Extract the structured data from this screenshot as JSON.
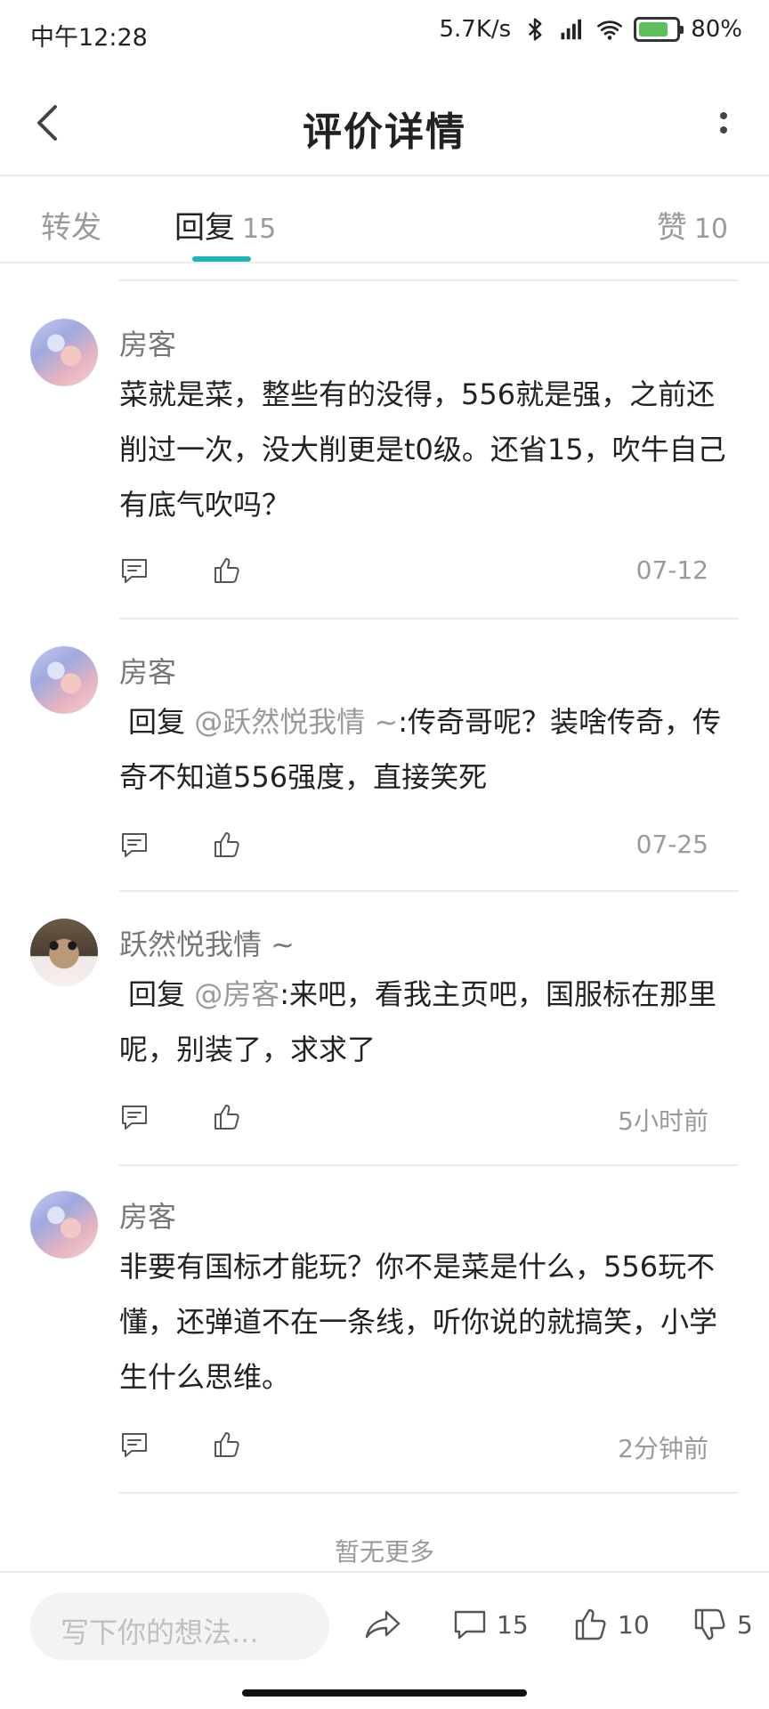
{
  "status_bar": {
    "time": "中午12:28",
    "network_speed": "5.7K/s",
    "battery_percent": "80%",
    "battery_level": 0.8,
    "icons": [
      "bluetooth-icon",
      "signal-icon",
      "wifi-icon",
      "battery-icon"
    ]
  },
  "header": {
    "title": "评价详情",
    "back_icon": "chevron-left-icon",
    "more_icon": "more-vertical-icon"
  },
  "tabs": {
    "forward": {
      "label": "转发"
    },
    "reply": {
      "label": "回复",
      "count": "15"
    },
    "like": {
      "label": "赞",
      "count": "10"
    },
    "active": "reply",
    "accent_color": "#1fb5b5"
  },
  "comments": [
    {
      "author": "房客",
      "avatar": "anime-avatar",
      "reply_prefix": "",
      "mention": "",
      "text": "菜就是菜，整些有的没得，556就是强，之前还削过一次，没大削更是t0级。还省15，吹牛自己有底气吹吗？",
      "date": "07-12"
    },
    {
      "author": "房客",
      "avatar": "anime-avatar",
      "reply_prefix": "回复",
      "mention": "@跃然悦我情 ~",
      "text": ":传奇哥呢？装啥传奇，传奇不知道556强度，直接笑死",
      "date": "07-25"
    },
    {
      "author": "跃然悦我情 ~",
      "avatar": "cat-avatar",
      "reply_prefix": "回复",
      "mention": "@房客",
      "text": ":来吧，看我主页吧，国服标在那里呢，别装了，求求了",
      "date": "5小时前"
    },
    {
      "author": "房客",
      "avatar": "anime-avatar",
      "reply_prefix": "",
      "mention": "",
      "text": "非要有国标才能玩？你不是菜是什么，556玩不懂，还弹道不在一条线，听你说的就搞笑，小学生什么思维。",
      "date": "2分钟前"
    }
  ],
  "no_more_text": "暂无更多",
  "bottom_bar": {
    "input_placeholder": "写下你的想法...",
    "comment_count": "15",
    "like_count": "10",
    "dislike_count": "5",
    "icons": [
      "share-icon",
      "comment-icon",
      "thumbs-up-icon",
      "thumbs-down-icon"
    ]
  }
}
